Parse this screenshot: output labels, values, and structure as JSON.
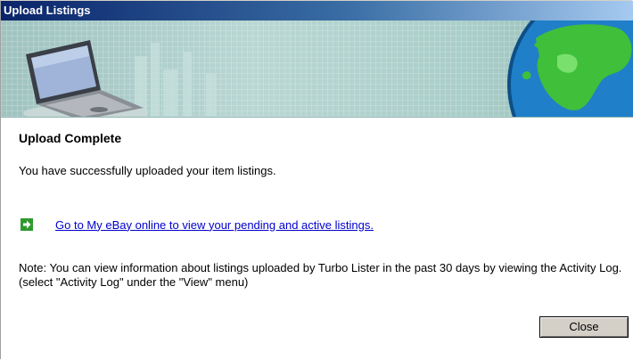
{
  "window": {
    "title": "Upload Listings"
  },
  "main": {
    "heading": "Upload Complete",
    "message": "You have successfully uploaded your item listings.",
    "link_text": "Go to My eBay online to view your pending and active listings.",
    "note": "Note: You can view information about listings uploaded by Turbo Lister in the past 30 days by viewing the Activity Log. (select \"Activity Log\" under the \"View\" menu)"
  },
  "buttons": {
    "close_label": "Close"
  },
  "icons": {
    "banner_left": "laptop-icon",
    "banner_right": "globe-icon",
    "link": "green-arrow-icon"
  },
  "colors": {
    "title_bar": "#0a246a",
    "link": "#0000cc",
    "arrow": "#2e9a2e"
  }
}
